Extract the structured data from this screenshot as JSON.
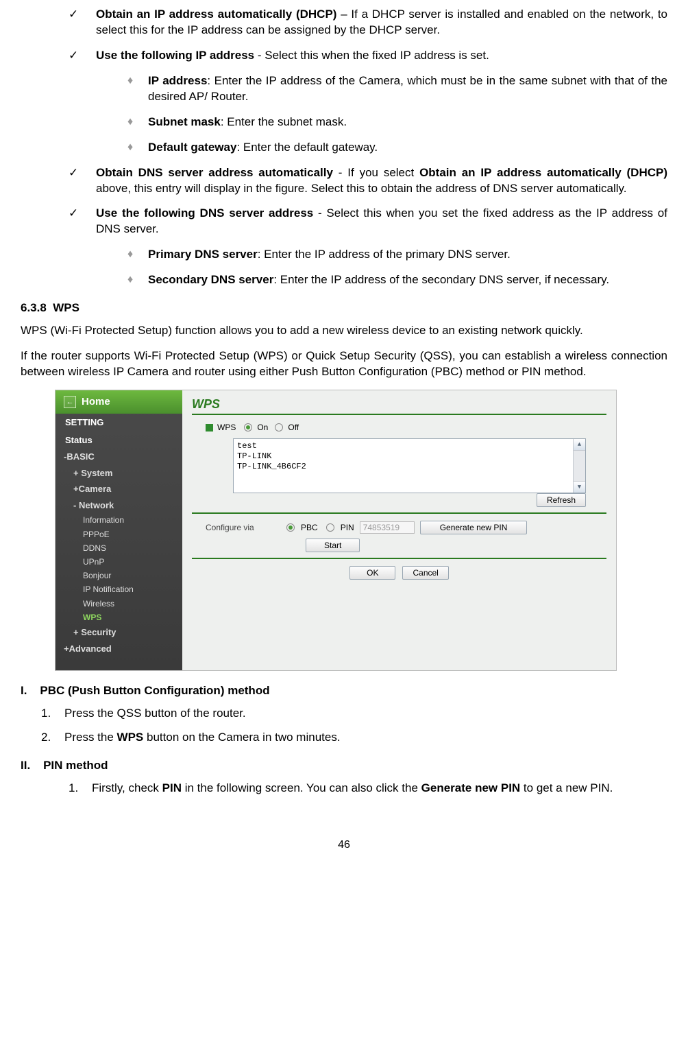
{
  "bullets": {
    "dhcp_bold": "Obtain an IP address automatically (DHCP)",
    "dhcp_text": " – If a DHCP server is installed and enabled on the network, to select this for the IP address can be assigned by the DHCP server.",
    "fixedip_bold": "Use the following IP address",
    "fixedip_text": " - Select this when the fixed IP address is set.",
    "ipaddr_bold": "IP address",
    "ipaddr_text": ": Enter the IP address of the Camera, which must be in the same subnet with that of the desired AP/ Router.",
    "subnet_bold": "Subnet mask",
    "subnet_text": ": Enter the subnet mask.",
    "gw_bold": "Default gateway",
    "gw_text": ": Enter the default gateway.",
    "dnsauto_bold": "Obtain DNS server address automatically",
    "dnsauto_mid1": " - If you select ",
    "dnsauto_bold2": "Obtain an IP address automatically (DHCP)",
    "dnsauto_text": " above, this entry will display in the figure. Select this to obtain the address of DNS server automatically.",
    "dnsfixed_bold": "Use the following DNS server address",
    "dnsfixed_text": " - Select this when you set the fixed address as the IP address of DNS server.",
    "pdns_bold": "Primary DNS server",
    "pdns_text": ": Enter the IP address of the primary DNS server.",
    "sdns_bold": "Secondary DNS server",
    "sdns_text": ": Enter the IP address of the secondary DNS server, if necessary."
  },
  "section": {
    "number": "6.3.8",
    "title": "WPS",
    "para1": "WPS (Wi-Fi Protected Setup) function allows you to add a new wireless device to an existing network quickly.",
    "para2": "If the router supports Wi-Fi Protected Setup (WPS) or Quick Setup Security (QSS), you can establish a wireless connection between wireless IP Camera and router using either Push Button Configuration (PBC) method or PIN method."
  },
  "wps": {
    "home": "Home",
    "setting": "SETTING",
    "status": "Status",
    "basic": "-BASIC",
    "system": "+ System",
    "camera": "+Camera",
    "network": "- Network",
    "leaves": [
      "Information",
      "PPPoE",
      "DDNS",
      "UPnP",
      "Bonjour",
      "IP Notification",
      "Wireless",
      "WPS"
    ],
    "security": "+ Security",
    "advanced": "+Advanced",
    "panel_title": "WPS",
    "wps_label": "WPS",
    "on": "On",
    "off": "Off",
    "networks": [
      "test",
      "TP-LINK",
      "TP-LINK_4B6CF2"
    ],
    "refresh": "Refresh",
    "configure": "Configure via",
    "pbc": "PBC",
    "pin": "PIN",
    "pin_value": "74853519",
    "gen": "Generate new PIN",
    "start": "Start",
    "ok": "OK",
    "cancel": "Cancel"
  },
  "pbc": {
    "heading_num": "I.",
    "heading": "PBC (Push Button Configuration) method",
    "step1_num": "1.",
    "step1": "Press the QSS button of the router.",
    "step2_num": "2.",
    "step2_a": "Press the ",
    "step2_b": "WPS",
    "step2_c": " button on the Camera in two minutes."
  },
  "pin": {
    "heading_num": "II.",
    "heading": "PIN method",
    "step1_num": "1.",
    "step1_a": "Firstly, check ",
    "step1_b": "PIN",
    "step1_c": " in the following screen. You can also click the ",
    "step1_d": "Generate new PIN",
    "step1_e": " to get a new PIN."
  },
  "page_number": "46"
}
